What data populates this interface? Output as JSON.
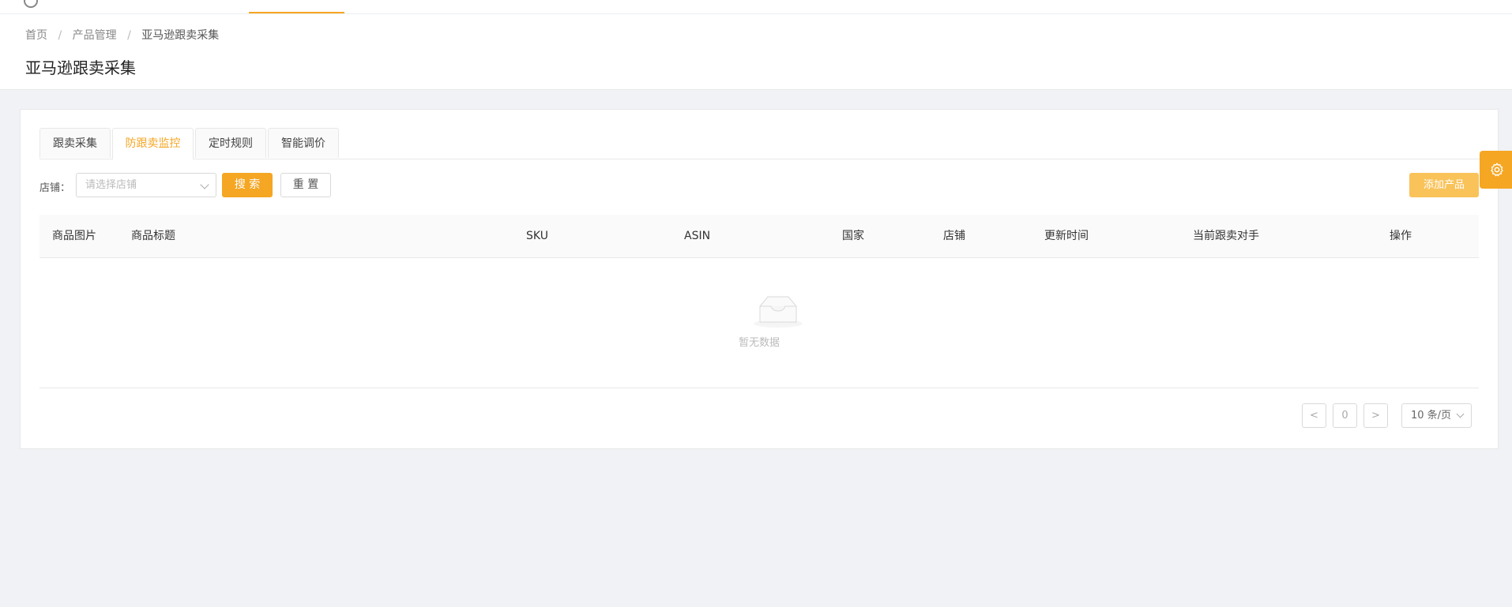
{
  "colors": {
    "accent": "#f5a623",
    "accent_light": "#f9c35a"
  },
  "breadcrumb": [
    {
      "label": "首页"
    },
    {
      "label": "产品管理"
    },
    {
      "label": "亚马逊跟卖采集"
    }
  ],
  "breadcrumb_separator": "/",
  "page_title": "亚马逊跟卖采集",
  "tabs": [
    {
      "label": "跟卖采集",
      "active": false
    },
    {
      "label": "防跟卖监控",
      "active": true
    },
    {
      "label": "定时规则",
      "active": false
    },
    {
      "label": "智能调价",
      "active": false
    }
  ],
  "filter": {
    "store_label": "店铺：",
    "store_placeholder": "请选择店铺",
    "search_button": "搜 索",
    "reset_button": "重 置",
    "add_button": "添加产品"
  },
  "table": {
    "columns": [
      "商品图片",
      "商品标题",
      "SKU",
      "ASIN",
      "国家",
      "店铺",
      "更新时间",
      "当前跟卖对手",
      "操作"
    ],
    "empty_text": "暂无数据"
  },
  "pagination": {
    "prev_icon": "chevron-left-icon",
    "next_icon": "chevron-right-icon",
    "current_page": "0",
    "page_size": "10 条/页"
  },
  "settings_icon": "gear-icon"
}
